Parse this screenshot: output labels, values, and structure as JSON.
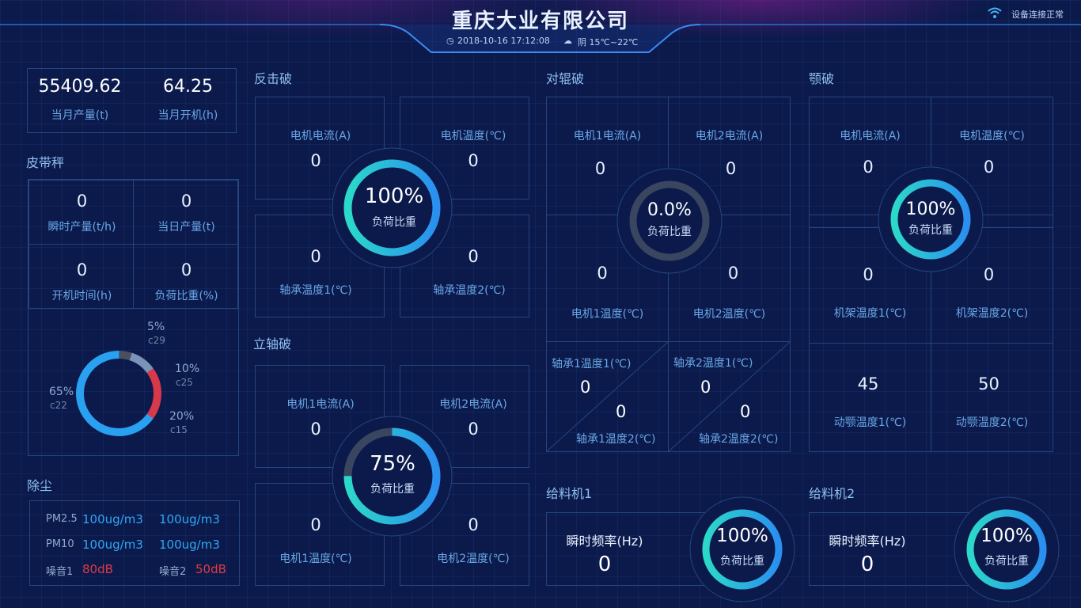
{
  "header": {
    "title": "重庆大业有限公司",
    "datetime": "2018-10-16  17:12:08",
    "weather": "阴 15℃~22℃",
    "status": "设备连接正常"
  },
  "summary": {
    "output_value": "55409.62",
    "output_label": "当月产量(t)",
    "hours_value": "64.25",
    "hours_label": "当月开机(h)"
  },
  "belt": {
    "title": "皮带秤",
    "cells": [
      {
        "value": "0",
        "label": "瞬时产量(t/h)"
      },
      {
        "value": "0",
        "label": "当日产量(t)"
      },
      {
        "value": "0",
        "label": "开机时间(h)"
      },
      {
        "value": "0",
        "label": "负荷比重(%)"
      }
    ],
    "chart_data": {
      "type": "pie",
      "slices": [
        {
          "name": "c22",
          "label": "65%",
          "value": 65,
          "color": "#2aa0f0"
        },
        {
          "name": "c29",
          "label": "5%",
          "value": 5,
          "color": "#4a4f5e"
        },
        {
          "name": "c25",
          "label": "10%",
          "value": 10,
          "color": "#7b93b8"
        },
        {
          "name": "c15",
          "label": "20%",
          "value": 20,
          "color": "#d8394a"
        }
      ]
    }
  },
  "dust": {
    "title": "除尘",
    "pm25_label": "PM2.5",
    "pm25_v1": "100ug/m3",
    "pm25_v2": "100ug/m3",
    "pm10_label": "PM10",
    "pm10_v1": "100ug/m3",
    "pm10_v2": "100ug/m3",
    "noise1_label": "噪音1",
    "noise1_value": "80dB",
    "noise2_label": "噪音2",
    "noise2_value": "50dB"
  },
  "impact": {
    "title": "反击破",
    "tl_label": "电机电流(A)",
    "tl_value": "0",
    "tr_label": "电机温度(℃)",
    "tr_value": "0",
    "bl_label": "轴承温度1(℃)",
    "bl_value": "0",
    "br_label": "轴承温度2(℃)",
    "br_value": "0",
    "ring_value": "100%",
    "ring_label": "负荷比重",
    "ring_pct": 100
  },
  "vertical": {
    "title": "立轴破",
    "tl_label": "电机1电流(A)",
    "tl_value": "0",
    "tr_label": "电机2电流(A)",
    "tr_value": "0",
    "bl_label": "电机1温度(℃)",
    "bl_value": "0",
    "br_label": "电机2温度(℃)",
    "br_value": "0",
    "ring_value": "75%",
    "ring_label": "负荷比重",
    "ring_pct": 75
  },
  "roller": {
    "title": "对辊破",
    "tl_label": "电机1电流(A)",
    "tl_value": "0",
    "tr_label": "电机2电流(A)",
    "tr_value": "0",
    "ml_label": "电机1温度(℃)",
    "ml_value": "0",
    "mr_label": "电机2温度(℃)",
    "mr_value": "0",
    "b1_top_label": "轴承1温度1(℃)",
    "b1_top_value": "0",
    "b1_bot_label": "轴承1温度2(℃)",
    "b1_bot_value": "0",
    "b2_top_label": "轴承2温度1(℃)",
    "b2_top_value": "0",
    "b2_bot_label": "轴承2温度2(℃)",
    "b2_bot_value": "0",
    "ring_value": "0.0%",
    "ring_label": "负荷比重",
    "ring_pct": 0
  },
  "jaw": {
    "title": "颚破",
    "tl_label": "电机电流(A)",
    "tl_value": "0",
    "tr_label": "电机温度(℃)",
    "tr_value": "0",
    "ml_label": "机架温度1(℃)",
    "ml_value": "0",
    "mr_label": "机架温度2(℃)",
    "mr_value": "0",
    "bl_label": "动颚温度1(℃)",
    "bl_value": "45",
    "br_label": "动颚温度2(℃)",
    "br_value": "50",
    "ring_value": "100%",
    "ring_label": "负荷比重",
    "ring_pct": 100
  },
  "feeder1": {
    "title": "给料机1",
    "freq_label": "瞬时频率(Hz)",
    "freq_value": "0",
    "ring_value": "100%",
    "ring_label": "负荷比重",
    "ring_pct": 100
  },
  "feeder2": {
    "title": "给料机2",
    "freq_label": "瞬时频率(Hz)",
    "freq_value": "0",
    "ring_value": "100%",
    "ring_label": "负荷比重",
    "ring_pct": 100
  },
  "colors": {
    "accent_start": "#2bd9c9",
    "accent_end": "#2a8ff0",
    "track": "#3a4660",
    "panel_border": "#24457f"
  }
}
